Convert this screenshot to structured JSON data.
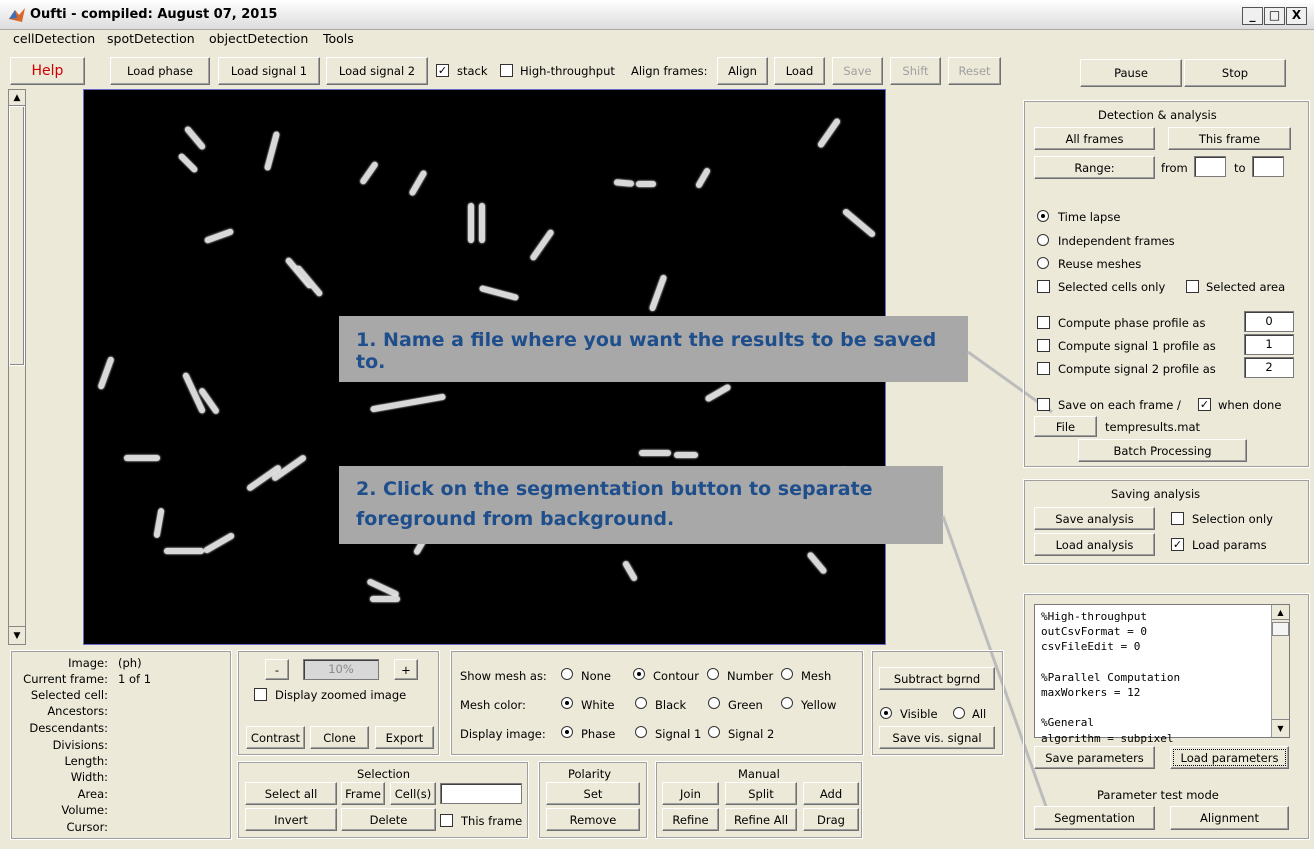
{
  "window": {
    "title": "Oufti - compiled:  August 07, 2015",
    "minimize": "_",
    "maximize": "□",
    "close": "X"
  },
  "menu": [
    "cellDetection",
    "spotDetection",
    "objectDetection",
    "Tools"
  ],
  "toolbar": {
    "help": "Help",
    "load_phase": "Load phase",
    "load_signal1": "Load signal 1",
    "load_signal2": "Load signal 2",
    "stack": "stack",
    "stack_checked": true,
    "high_throughput": "High-throughput",
    "align_frames": "Align frames:",
    "align": "Align",
    "load": "Load",
    "save": "Save",
    "shift": "Shift",
    "reset": "Reset",
    "pause": "Pause",
    "stop": "Stop"
  },
  "detection": {
    "title": "Detection & analysis",
    "all_frames": "All frames",
    "this_frame": "This frame",
    "range": "Range:",
    "from": "from",
    "to": "to",
    "time_lapse": "Time lapse",
    "independent_frames": "Independent frames",
    "reuse_meshes": "Reuse meshes",
    "selected_cells_only": "Selected cells only",
    "selected_area": "Selected area",
    "compute_phase": "Compute phase profile as",
    "compute_phase_val": "0",
    "compute_signal1": "Compute signal 1 profile as",
    "compute_signal1_val": "1",
    "compute_signal2": "Compute signal 2 profile as",
    "compute_signal2_val": "2",
    "save_each_frame": "Save on each frame /",
    "when_done": "when done",
    "file": "File",
    "filename": "tempresults.mat",
    "batch": "Batch Processing"
  },
  "saving": {
    "title": "Saving analysis",
    "save_analysis": "Save analysis",
    "selection_only": "Selection only",
    "load_analysis": "Load analysis",
    "load_params": "Load params"
  },
  "params": {
    "lines": "%High-throughput\noutCsvFormat = 0\ncsvFileEdit = 0\n\n%Parallel Computation\nmaxWorkers = 12\n\n%General\nalgorithm = subpixel",
    "save_parameters": "Save parameters",
    "load_parameters": "Load parameters",
    "test_mode": "Parameter test mode",
    "segmentation": "Segmentation",
    "alignment": "Alignment"
  },
  "info": {
    "image": "Image:",
    "image_val": "(ph)",
    "current_frame": "Current frame:",
    "current_frame_val": "1 of 1",
    "selected_cell": "Selected cell:",
    "ancestors": "Ancestors:",
    "descendants": "Descendants:",
    "divisions": "Divisions:",
    "length": "Length:",
    "width": "Width:",
    "area": "Area:",
    "volume": "Volume:",
    "cursor": "Cursor:"
  },
  "zoom": {
    "minus": "-",
    "value": "10%",
    "plus": "+",
    "display_zoomed": "Display zoomed image",
    "contrast": "Contrast",
    "clone": "Clone",
    "export": "Export"
  },
  "mesh": {
    "show_as": "Show mesh as:",
    "none": "None",
    "contour": "Contour",
    "number": "Number",
    "mesh": "Mesh",
    "color": "Mesh color:",
    "white": "White",
    "black": "Black",
    "green": "Green",
    "yellow": "Yellow",
    "display_image": "Display image:",
    "phase": "Phase",
    "signal1": "Signal 1",
    "signal2": "Signal 2"
  },
  "bgrnd": {
    "subtract": "Subtract bgrnd",
    "visible": "Visible",
    "all": "All",
    "save_vis": "Save vis. signal"
  },
  "selection": {
    "title": "Selection",
    "select_all": "Select all",
    "frame": "Frame",
    "cells": "Cell(s)",
    "invert": "Invert",
    "delete": "Delete",
    "this_frame": "This frame"
  },
  "polarity": {
    "title": "Polarity",
    "set": "Set",
    "remove": "Remove"
  },
  "manual": {
    "title": "Manual",
    "join": "Join",
    "split": "Split",
    "add": "Add",
    "refine": "Refine",
    "refine_all": "Refine All",
    "drag": "Drag"
  },
  "callouts": {
    "step1": "1.  Name a file where you want the results to be saved to.",
    "step2": "2.  Click on the segmentation button to separate foreground from background."
  }
}
